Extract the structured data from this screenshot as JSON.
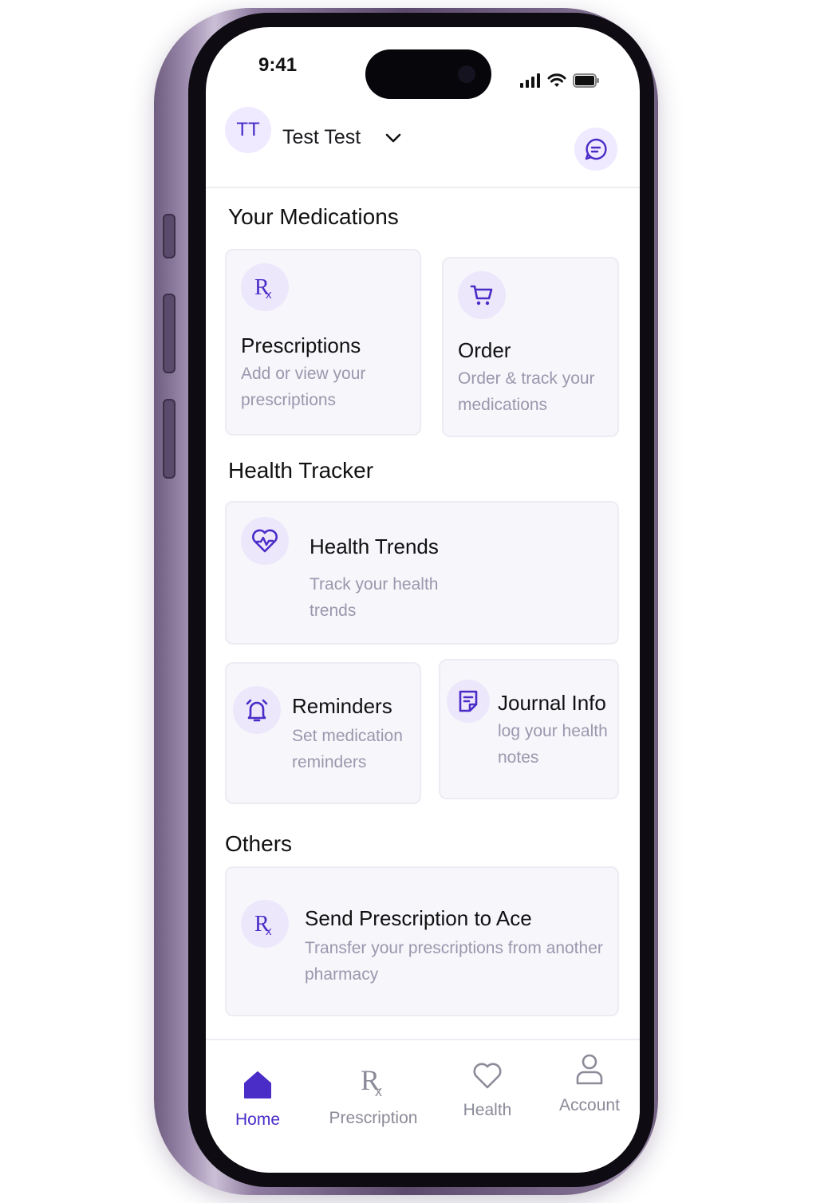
{
  "status_bar": {
    "time": "9:41"
  },
  "header": {
    "avatar_initials": "TT",
    "user_name": "Test Test"
  },
  "sections": {
    "medications": "Your Medications",
    "health_tracker": "Health Tracker",
    "others": "Others"
  },
  "cards": {
    "prescriptions": {
      "title": "Prescriptions",
      "description": "Add or view your prescriptions",
      "icon": "rx-icon"
    },
    "order": {
      "title": "Order",
      "description": "Order & track your medications",
      "icon": "cart-icon"
    },
    "health_trends": {
      "title": "Health Trends",
      "description": "Track your health trends",
      "icon": "heart-pulse-icon"
    },
    "reminders": {
      "title": "Reminders",
      "description": "Set medication reminders",
      "icon": "alarm-icon"
    },
    "journal": {
      "title": "Journal Info",
      "description": "log your health notes",
      "icon": "journal-icon"
    },
    "send_prescription": {
      "title": "Send Prescription to Ace",
      "description": "Transfer your prescriptions from another pharmacy",
      "icon": "rx-icon"
    }
  },
  "bottom_nav": [
    {
      "label": "Home",
      "icon": "home-icon",
      "active": true
    },
    {
      "label": "Prescription",
      "icon": "rx-icon",
      "active": false
    },
    {
      "label": "Health",
      "icon": "heart-icon",
      "active": false
    },
    {
      "label": "Account",
      "icon": "user-icon",
      "active": false
    }
  ],
  "colors": {
    "accent": "#4a2cc7",
    "card_bg": "#f7f6fb",
    "icon_bg": "#ece7fb",
    "muted_text": "#9b97ad"
  }
}
